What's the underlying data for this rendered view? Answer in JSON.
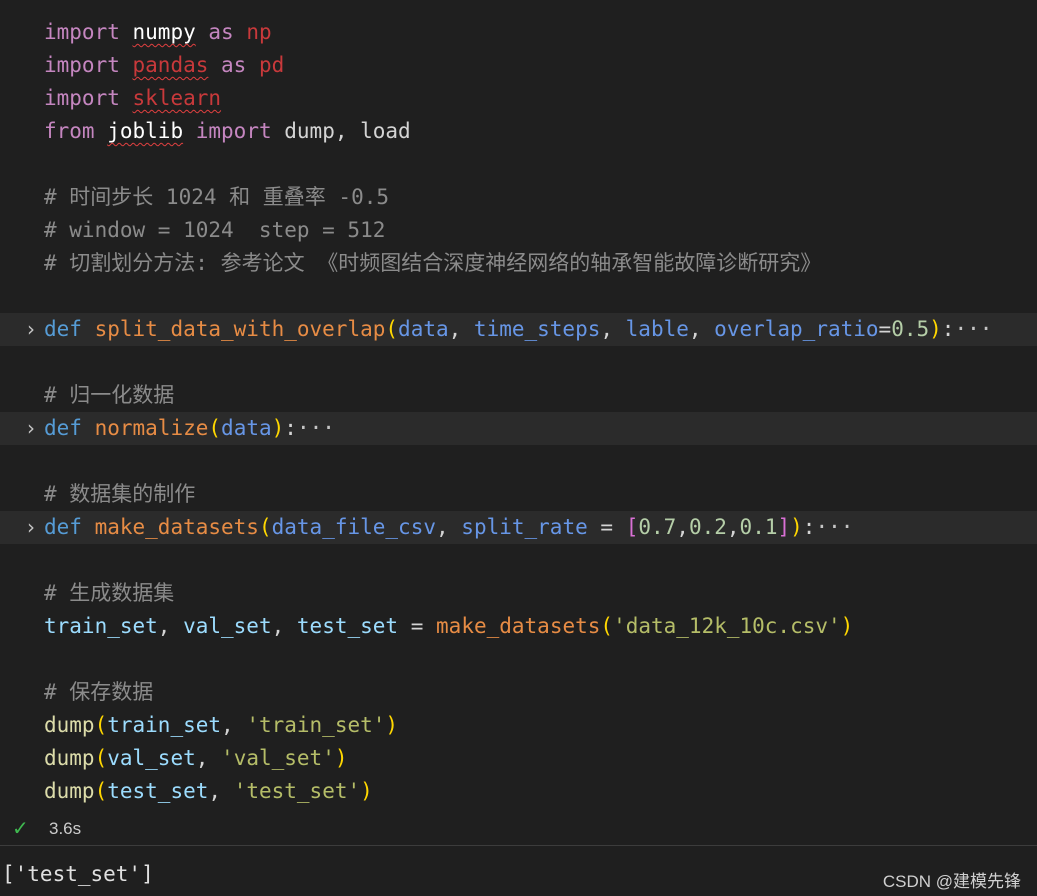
{
  "code": {
    "l1": {
      "kw": "import",
      "mod": "numpy",
      "as": "as",
      "alias": "np"
    },
    "l2": {
      "kw": "import",
      "mod": "pandas",
      "as": "as",
      "alias": "pd"
    },
    "l3": {
      "kw": "import",
      "mod": "sklearn"
    },
    "l4": {
      "kw": "from",
      "mod": "joblib",
      "kw2": "import",
      "names": "dump, load"
    },
    "c1": "# 时间步长 1024 和 重叠率 -0.5",
    "c2": "# window = 1024  step = 512",
    "c3": "# 切割划分方法: 参考论文 《时频图结合深度神经网络的轴承智能故障诊断研究》",
    "f1": {
      "def": "def",
      "name": "split_data_with_overlap",
      "p1": "data",
      "p2": "time_steps",
      "p3": "lable",
      "p4": "overlap_ratio",
      "eq": "=",
      "val": "0.5",
      "ellipsis": "···"
    },
    "c4": "# 归一化数据",
    "f2": {
      "def": "def",
      "name": "normalize",
      "p1": "data",
      "ellipsis": "···"
    },
    "c5": "# 数据集的制作",
    "f3": {
      "def": "def",
      "name": "make_datasets",
      "p1": "data_file_csv",
      "p2": "split_rate",
      "eq": "=",
      "v1": "0.7",
      "v2": "0.2",
      "v3": "0.1",
      "ellipsis": "···"
    },
    "c6": "# 生成数据集",
    "a1": {
      "v1": "train_set",
      "v2": "val_set",
      "v3": "test_set",
      "eq": "=",
      "fn": "make_datasets",
      "arg": "'data_12k_10c.csv'"
    },
    "c7": "# 保存数据",
    "d1": {
      "fn": "dump",
      "v": "train_set",
      "s": "'train_set'"
    },
    "d2": {
      "fn": "dump",
      "v": "val_set",
      "s": "'val_set'"
    },
    "d3": {
      "fn": "dump",
      "v": "test_set",
      "s": "'test_set'"
    }
  },
  "status": {
    "icon": "check-icon",
    "time": "3.6s"
  },
  "output": {
    "text": "['test_set']"
  },
  "watermark": "CSDN @建模先锋",
  "colors": {
    "background": "#1f1f1f",
    "keyword": "#c586c0",
    "function_def": "#e78c45",
    "parameter": "#6796e6",
    "comment": "#8b8b8b",
    "check": "#3fb950"
  }
}
